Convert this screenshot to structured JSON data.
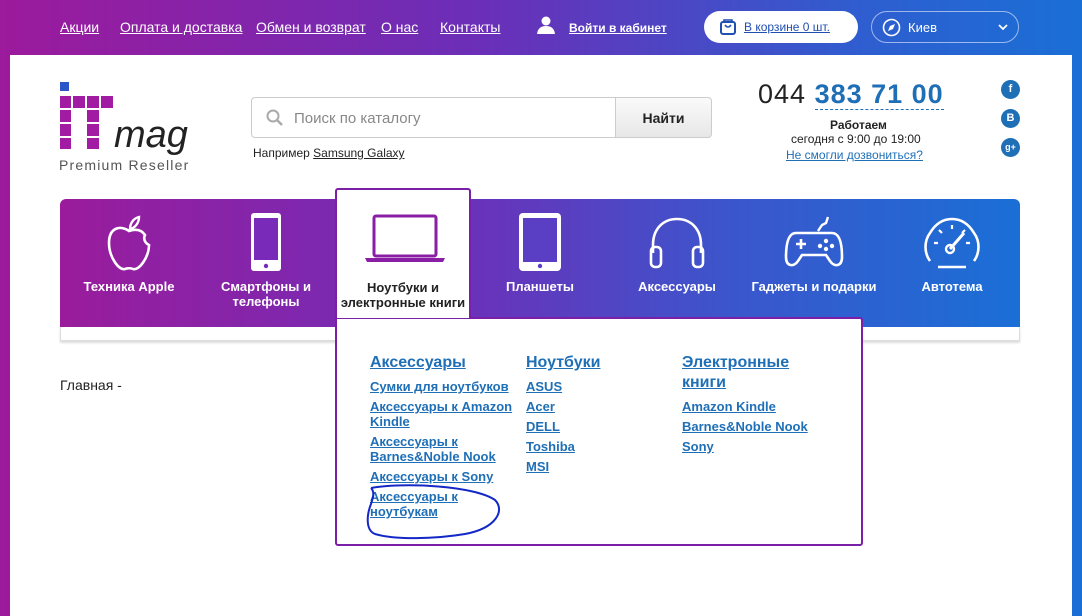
{
  "topbar": {
    "links": [
      "Акции",
      "Оплата и доставка",
      "Обмен и возврат",
      "О нас",
      "Контакты"
    ],
    "login_label": "Войти в кабинет",
    "cart_label": "В корзине 0 шт.",
    "city": "Киев"
  },
  "header": {
    "logo_text_it": "IT",
    "logo_text_mag": "mag",
    "logo_tagline": "Premium Reseller",
    "search": {
      "placeholder": "Поиск по каталогу",
      "button_label": "Найти",
      "example_prefix": "Например",
      "example_link": "Samsung Galaxy"
    },
    "phone": {
      "code": "044",
      "number": "383 71 00",
      "hours_title": "Работаем",
      "hours": "сегодня с 9:00 до 19:00",
      "callback": "Не смогли дозвониться?"
    },
    "social": [
      {
        "icon": "facebook-icon",
        "glyph": "f"
      },
      {
        "icon": "vkontakte-icon",
        "glyph": "B"
      },
      {
        "icon": "google-plus-icon",
        "glyph": "g+"
      }
    ]
  },
  "nav": {
    "items": [
      {
        "label": "Техника Apple",
        "icon": "apple-icon"
      },
      {
        "label": "Смартфоны и телефоны",
        "icon": "smartphone-icon"
      },
      {
        "label": "Ноутбуки и электронные книги",
        "icon": "laptop-icon",
        "active": true
      },
      {
        "label": "Планшеты",
        "icon": "tablet-icon"
      },
      {
        "label": "Аксессуары",
        "icon": "headphones-icon"
      },
      {
        "label": "Гаджеты и подарки",
        "icon": "gamepad-icon"
      },
      {
        "label": "Автотема",
        "icon": "speedometer-icon"
      }
    ]
  },
  "dropdown": {
    "columns": [
      {
        "title": "Аксессуары",
        "links": [
          "Сумки для ноутбуков",
          "Аксессуары к Amazon Kindle",
          "Аксессуары к Barnes&Noble Nook",
          "Аксессуары к Sony",
          "Аксессуары к ноутбукам"
        ]
      },
      {
        "title": "Ноутбуки",
        "links": [
          "ASUS",
          "Acer",
          "DELL",
          "Toshiba",
          "MSI"
        ]
      },
      {
        "title": "Электронные книги",
        "links": [
          "Amazon Kindle",
          "Barnes&Noble Nook",
          "Sony"
        ]
      }
    ]
  },
  "breadcrumb": "Главная  -",
  "colors": {
    "accent_purple": "#9a1c9c",
    "accent_blue": "#1f6fb7",
    "link_blue": "#1f6fb7"
  }
}
